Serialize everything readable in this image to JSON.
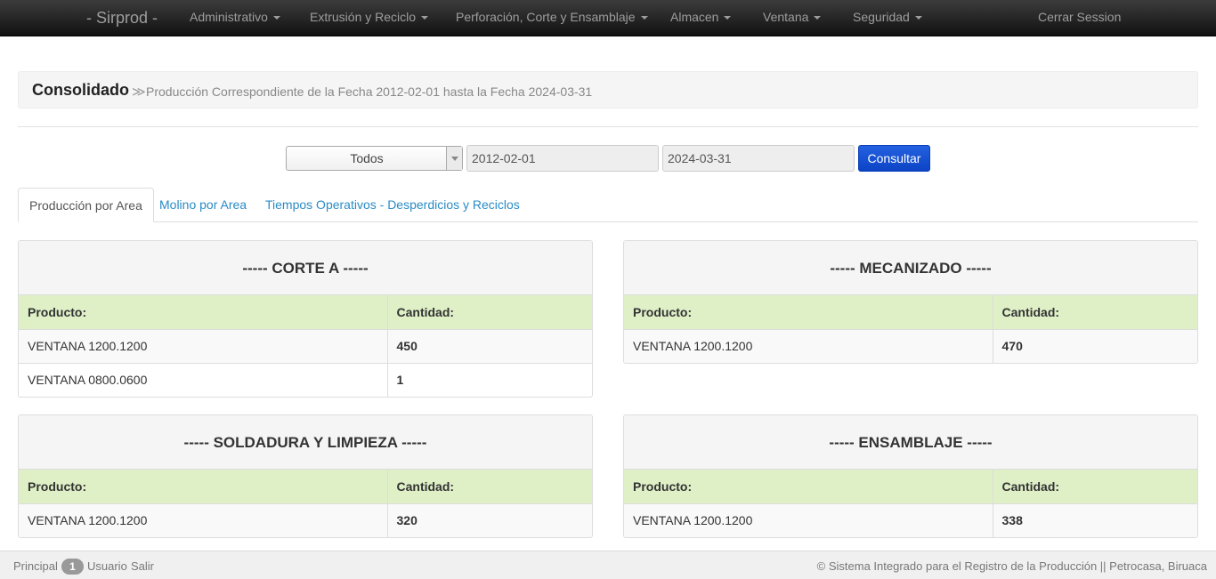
{
  "navbar": {
    "brand": "- Sirprod -",
    "items": [
      {
        "label": "Administrativo",
        "dropdown": true
      },
      {
        "label": "Extrusión y Reciclo",
        "dropdown": true
      },
      {
        "label": "Perforación, Corte y Ensamblaje",
        "dropdown": true
      },
      {
        "label": "Almacen",
        "dropdown": true
      },
      {
        "label": "Ventana",
        "dropdown": true
      },
      {
        "label": "Seguridad",
        "dropdown": true
      }
    ],
    "logout": "Cerrar Session"
  },
  "header": {
    "title": "Consolidado",
    "separator": "≫",
    "subtitle": "Producción Correspondiente de la Fecha 2012-02-01 hasta la Fecha 2024-03-31"
  },
  "filters": {
    "area_select": "Todos",
    "date_from": "2012-02-01",
    "date_to": "2024-03-31",
    "submit": "Consultar"
  },
  "tabs": [
    {
      "label": "Producción por Area",
      "active": true
    },
    {
      "label": "Molino por Area",
      "active": false
    },
    {
      "label": "Tiempos Operativos - Desperdicios y Reciclos",
      "active": false
    }
  ],
  "panels": [
    {
      "title": "----- CORTE A -----",
      "col_product": "Producto:",
      "col_qty": "Cantidad:",
      "rows": [
        {
          "product": "VENTANA 1200.1200",
          "qty": "450"
        },
        {
          "product": "VENTANA 0800.0600",
          "qty": "1"
        }
      ]
    },
    {
      "title": "----- MECANIZADO -----",
      "col_product": "Producto:",
      "col_qty": "Cantidad:",
      "rows": [
        {
          "product": "VENTANA 1200.1200",
          "qty": "470"
        }
      ]
    },
    {
      "title": "----- SOLDADURA Y LIMPIEZA -----",
      "col_product": "Producto:",
      "col_qty": "Cantidad:",
      "rows": [
        {
          "product": "VENTANA 1200.1200",
          "qty": "320"
        }
      ]
    },
    {
      "title": "----- ENSAMBLAJE -----",
      "col_product": "Producto:",
      "col_qty": "Cantidad:",
      "rows": [
        {
          "product": "VENTANA 1200.1200",
          "qty": "338"
        }
      ]
    }
  ],
  "footer": {
    "principal": "Principal",
    "badge": "1",
    "usuario": "Usuario",
    "salir": "Salir",
    "copyright": "© Sistema Integrado para el Registro de la Producción || Petrocasa, Biruaca"
  }
}
